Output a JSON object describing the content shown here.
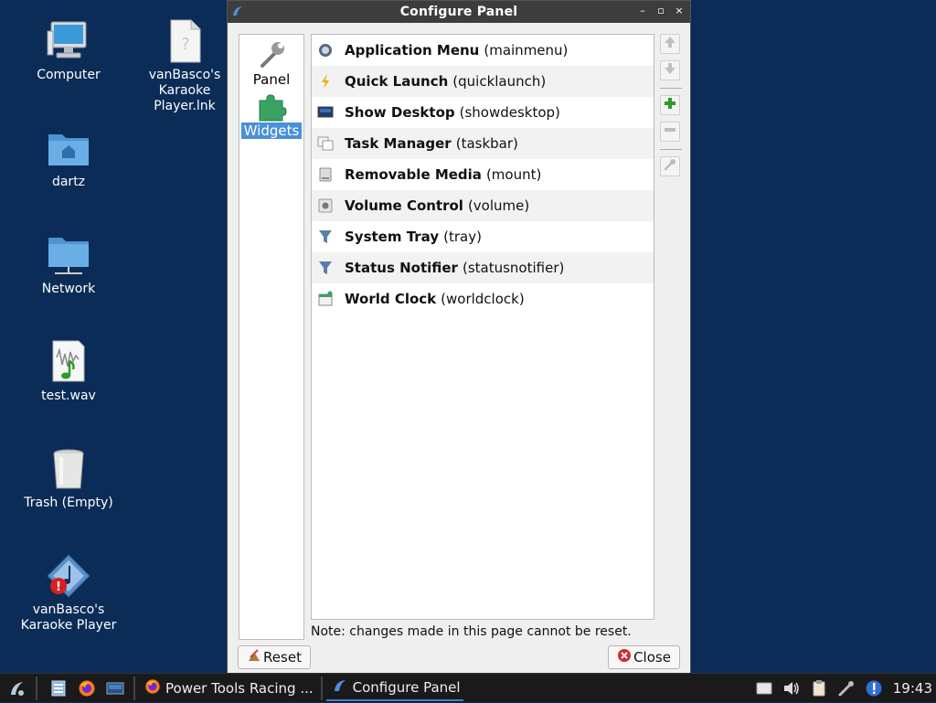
{
  "desktop": {
    "icons": [
      {
        "label": "Computer"
      },
      {
        "label": "vanBasco's Karaoke Player.lnk"
      },
      {
        "label": "dartz"
      },
      {
        "label": "Network"
      },
      {
        "label": "test.wav"
      },
      {
        "label": "Trash (Empty)"
      },
      {
        "label": "vanBasco's Karaoke Player"
      }
    ]
  },
  "dialog": {
    "title": "Configure Panel",
    "window_buttons": {
      "minimize": "–",
      "maximize": "▫",
      "close": "×"
    },
    "sidebar": [
      {
        "label": "Panel",
        "icon": "wrench-icon",
        "selected": false
      },
      {
        "label": "Widgets",
        "icon": "puzzle-piece-icon",
        "selected": true
      }
    ],
    "widgets": [
      {
        "name": "Application Menu",
        "id": "(mainmenu)",
        "icon": "menu-icon"
      },
      {
        "name": "Quick Launch",
        "id": "(quicklaunch)",
        "icon": "lightning-icon"
      },
      {
        "name": "Show Desktop",
        "id": "(showdesktop)",
        "icon": "desktop-icon"
      },
      {
        "name": "Task Manager",
        "id": "(taskbar)",
        "icon": "windows-icon"
      },
      {
        "name": "Removable Media",
        "id": "(mount)",
        "icon": "drive-icon"
      },
      {
        "name": "Volume Control",
        "id": "(volume)",
        "icon": "speaker-icon"
      },
      {
        "name": "System Tray",
        "id": "(tray)",
        "icon": "tray-icon"
      },
      {
        "name": "Status Notifier",
        "id": "(statusnotifier)",
        "icon": "notifier-icon"
      },
      {
        "name": "World Clock",
        "id": "(worldclock)",
        "icon": "clock-icon"
      }
    ],
    "note": "Note: changes made in this page cannot be reset.",
    "reset_label": "Reset",
    "close_label": "Close"
  },
  "taskbar": {
    "tasks": [
      {
        "label": "Power Tools Racing ...",
        "icon": "firefox-icon",
        "active": false
      },
      {
        "label": "Configure Panel",
        "icon": "lxqt-icon",
        "active": true
      }
    ],
    "clock": "19:43"
  },
  "colors": {
    "desktop_bg": "#0b2c57",
    "selection": "#4a90d9",
    "titlebar": "#3d3d3d"
  }
}
